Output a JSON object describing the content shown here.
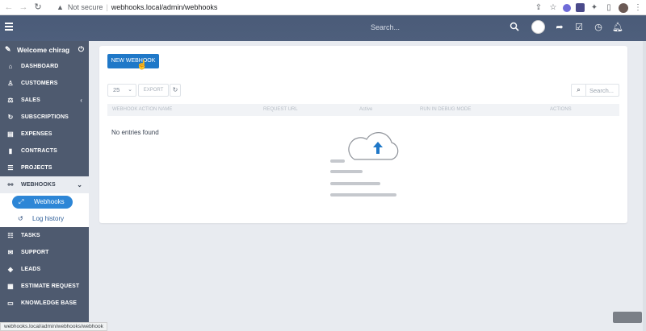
{
  "browser": {
    "security_label": "Not secure",
    "url": "webhooks.local/admin/webhooks",
    "status_url": "webhooks.local/admin/webhooks/webhook"
  },
  "topbar": {
    "search_placeholder": "Search..."
  },
  "sidebar": {
    "welcome": "Welcome chirag",
    "items": [
      {
        "label": "DASHBOARD",
        "icon": "home-icon"
      },
      {
        "label": "CUSTOMERS",
        "icon": "user-icon"
      },
      {
        "label": "SALES",
        "icon": "balance-scale-icon"
      },
      {
        "label": "SUBSCRIPTIONS",
        "icon": "refresh-icon"
      },
      {
        "label": "EXPENSES",
        "icon": "receipt-icon"
      },
      {
        "label": "CONTRACTS",
        "icon": "file-icon"
      },
      {
        "label": "PROJECTS",
        "icon": "list-icon"
      },
      {
        "label": "WEBHOOKS",
        "icon": "handshake-icon"
      },
      {
        "label": "TASKS",
        "icon": "tasks-icon"
      },
      {
        "label": "SUPPORT",
        "icon": "ticket-icon"
      },
      {
        "label": "LEADS",
        "icon": "tag-icon"
      },
      {
        "label": "ESTIMATE REQUEST",
        "icon": "table-icon"
      },
      {
        "label": "KNOWLEDGE BASE",
        "icon": "folder-icon"
      }
    ],
    "submenu": [
      {
        "label": "Webhooks",
        "icon": "link-icon"
      },
      {
        "label": "Log history",
        "icon": "history-icon"
      }
    ]
  },
  "main": {
    "new_button": "NEW WEBHOOK",
    "page_length": "25",
    "export_label": "EXPORT",
    "search_placeholder": "Search...",
    "columns": [
      "WEBHOOK ACTION NAME",
      "REQUEST URL",
      "Active",
      "RUN IN DEBUG MODE",
      "ACTIONS"
    ],
    "empty_message": "No entries found"
  },
  "colors": {
    "sidebar_bg": "#4e5a6f",
    "topbar_bg": "#4a5b78",
    "primary": "#1f78c8",
    "active_pill": "#2d86d6"
  }
}
